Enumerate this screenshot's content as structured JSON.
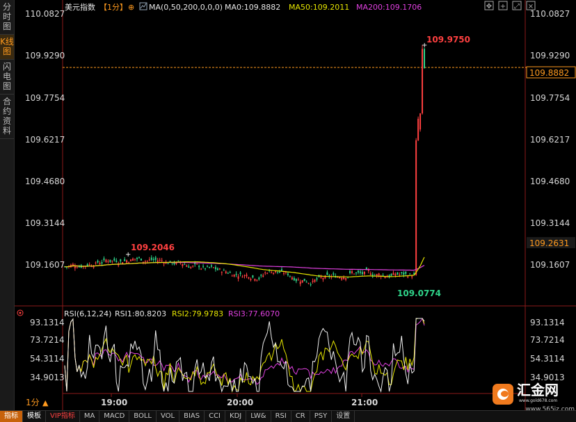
{
  "sidebar": {
    "tabs": [
      {
        "label": "分时图",
        "active": false
      },
      {
        "label": "K线图",
        "active": true
      },
      {
        "label": "闪电图",
        "active": false
      },
      {
        "label": "合约资料",
        "active": false
      }
    ]
  },
  "header": {
    "symbol": "美元指数",
    "period": "【1分】",
    "ma_params": "MA(0,50,200,0,0,0)",
    "ma0": "MA0:109.8882",
    "ma50": "MA50:109.2011",
    "ma200": "MA200:109.1706"
  },
  "colors": {
    "up": "#ff4040",
    "down": "#2fd48a",
    "ma50": "#e6e600",
    "ma200": "#e040e0",
    "axis": "#ff3b3b",
    "accent": "#ff9a1e"
  },
  "price_axis": {
    "ticks": [
      "110.0827",
      "109.9290",
      "109.7754",
      "109.6217",
      "109.4680",
      "109.3144",
      "109.1607"
    ],
    "current_price": "109.8882",
    "ma_price": "109.2631"
  },
  "annotations": {
    "high": "109.9750",
    "local_high": "109.2046",
    "low": "109.0774"
  },
  "rsi": {
    "title": "RSI(6,12,24)",
    "rsi1": "RSI1:80.8203",
    "rsi2": "RSI2:79.9783",
    "rsi3": "RSI3:77.6070",
    "ticks": [
      "93.1314",
      "73.7214",
      "54.3114",
      "34.9013"
    ]
  },
  "time_axis": {
    "period": "1分",
    "labels": [
      "19:00",
      "20:00",
      "21:00"
    ]
  },
  "toolbar": {
    "items": [
      "指标",
      "模板",
      "VIP指标",
      "MA",
      "MACD",
      "BOLL",
      "VOL",
      "BIAS",
      "CCI",
      "KDJ",
      "LW&",
      "RSI",
      "CR",
      "PSY",
      "设置"
    ]
  },
  "logo": {
    "name": "汇金网",
    "site": "www.gold678.com",
    "watermark": "www.565jz.com"
  },
  "chart_data": {
    "type": "candlestick",
    "ylim": [
      109.03,
      110.09
    ],
    "x_labels": [
      "19:00",
      "20:00",
      "21:00"
    ],
    "series_names": [
      "MA50",
      "MA200"
    ],
    "high": 109.975,
    "low": 109.0774,
    "last": 109.8882,
    "ma50_last": 109.2011,
    "ma200_last": 109.1706,
    "rsi": {
      "rsi1": 80.8203,
      "rsi2": 79.9783,
      "rsi3": 77.607,
      "ylim": [
        25,
        95
      ]
    }
  }
}
